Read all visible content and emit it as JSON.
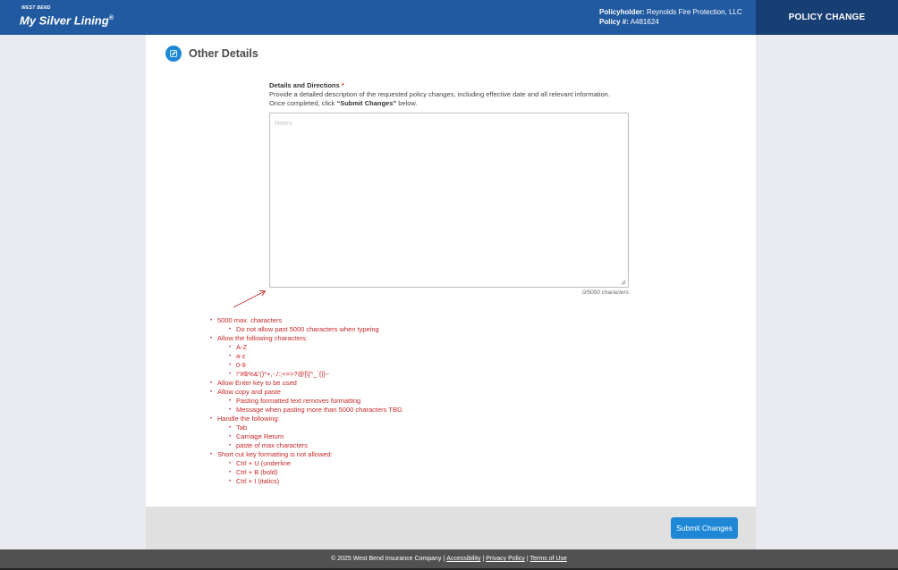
{
  "header": {
    "logo_small": "WEST BEND",
    "logo_main": "My Silver Lining",
    "logo_mark": "®",
    "policyholder_label": "Policyholder:",
    "policyholder_value": "Reynolds Fire Protection, LLC",
    "policy_label": "Policy #:",
    "policy_value": "A481624",
    "page_type": "POLICY CHANGE"
  },
  "section": {
    "icon": "pencil-icon",
    "title": "Other Details"
  },
  "field": {
    "label": "Details and Directions",
    "required_mark": "*",
    "help_prefix": "Provide a detailed description of the requested policy changes, including effective date and all relevant information. Once completed, click ",
    "help_emphasis": "“Submit Changes”",
    "help_suffix": " below.",
    "placeholder": "Notes",
    "value": "",
    "counter": "0/5000 characters"
  },
  "annotations": {
    "color": "#c62828",
    "i1": "5000 max. characters",
    "i1a": "Do not allow past 5000 characters when typeing",
    "i2": "Allow the following characters:",
    "i2a": "A-Z",
    "i2b": "a-z",
    "i2c": "0-9",
    "i2d": "!\"#$%&'()*+,-./:;<=>?@[\\]^_`{|}~",
    "i3": "Allow Enter key to be used",
    "i4": "Allow copy and paste",
    "i4a": "Pasting formatted text removes formatting",
    "i4b": "Message when pasting more than 5000 characters TBD.",
    "i5": "Handle the following:",
    "i5a": "Tab",
    "i5b": "Carriage Return",
    "i5c": "paste of max characters",
    "i6": "Short cut key formatting is not allowed:",
    "i6a": "Ctrl + U (underline",
    "i6b": "Ctrl + B (bold)",
    "i6c": "Ctrl + I (italics)"
  },
  "actions": {
    "submit_label": "Submit Changes"
  },
  "footer": {
    "copyright": "© 2025 West Bend Insurance Company",
    "sep": "|",
    "accessibility": "Accessibility",
    "privacy": "Privacy Policy",
    "terms": "Terms of Use"
  },
  "colors": {
    "header_bg": "#215aa0",
    "header_right_bg": "#183f74",
    "accent": "#1e88d7",
    "annotation": "#c62828"
  }
}
